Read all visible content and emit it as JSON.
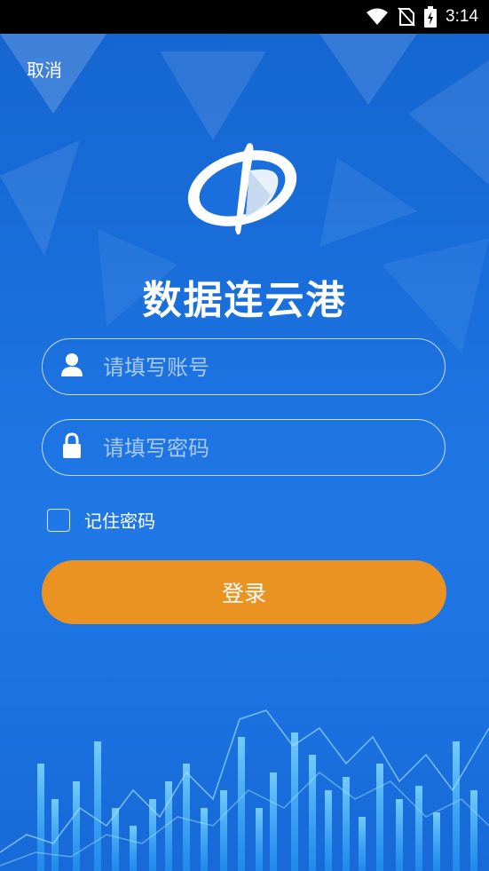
{
  "status_bar": {
    "time": "3:14",
    "icons": [
      "wifi-icon",
      "no-sim-icon",
      "battery-charging-icon"
    ]
  },
  "header": {
    "cancel_label": "取消"
  },
  "app": {
    "logo_icon": "app-logo-icon",
    "title": "数据连云港"
  },
  "form": {
    "account": {
      "icon": "user-icon",
      "placeholder": "请填写账号",
      "value": ""
    },
    "password": {
      "icon": "lock-icon",
      "placeholder": "请填写密码",
      "value": ""
    },
    "remember_label": "记住密码",
    "remember_checked": false,
    "login_label": "登录"
  },
  "colors": {
    "background": "#1a6fdc",
    "button": "#eb9322",
    "status_bar": "#000000"
  }
}
